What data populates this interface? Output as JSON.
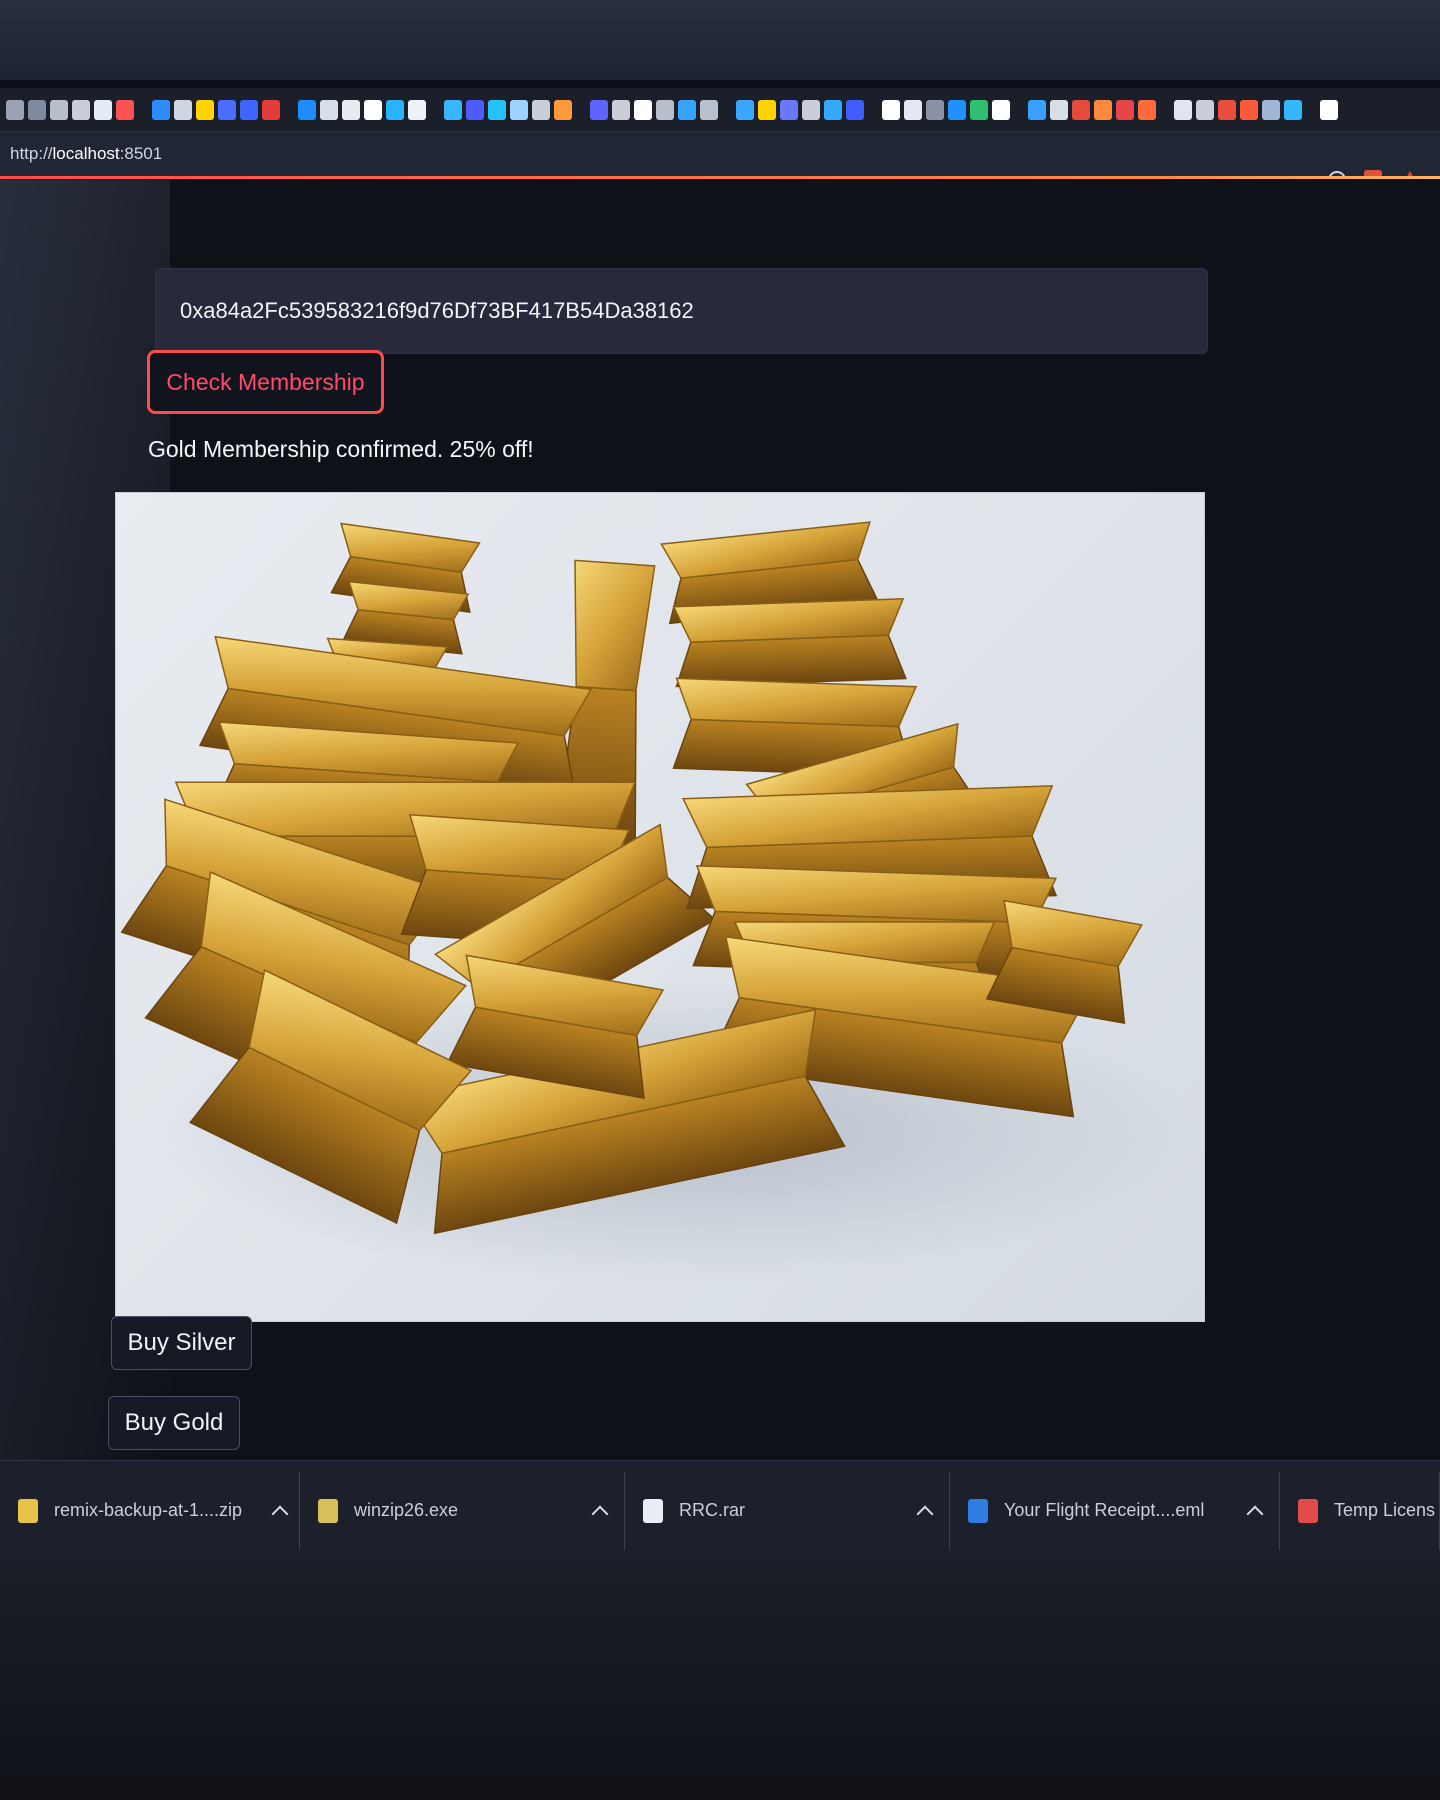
{
  "browser": {
    "url_scheme": "http://",
    "url_host": "localhost",
    "url_port": ":8501",
    "bookmark_icons": [
      "#9aa3b5",
      "#7f8aa0",
      "#b8bfcc",
      "#c8cdd8",
      "#e6ecf5",
      "#ff5252",
      "#2d8cff",
      "#cfd6e3",
      "#ffd400",
      "#4a6cff",
      "#3c66ff",
      "#e33a3a",
      "#1c8cff",
      "#d7deea",
      "#e8ecf2",
      "#ffffff",
      "#2ab3ff",
      "#eef2f7",
      "#38b6ff",
      "#4d5cff",
      "#24c2ff",
      "#9dd3ff",
      "#c7ced9",
      "#ff9a3c",
      "#5e63ff",
      "#c8cdd8",
      "#ffffff",
      "#b7bfcc",
      "#36a4ff",
      "#b7c0cf",
      "#39a6ff",
      "#ffd200",
      "#6a78ff",
      "#c8cdd8",
      "#35a8ff",
      "#3f5cff",
      "#ffffff",
      "#e4e9f1",
      "#8a93a6",
      "#1e90ff",
      "#2fbf71",
      "#ffffff",
      "#38a0ff",
      "#d8dde6",
      "#e64a3c",
      "#ff8a3c",
      "#e64646",
      "#ff6b3c",
      "#e0e5ee",
      "#c8cdd8",
      "#e94e3c",
      "#ff5a3c",
      "#9fb6d4",
      "#34b6ff",
      "#ffffff"
    ]
  },
  "form": {
    "wallet_address": "0xa84a2Fc539583216f9d76Df73BF417B54Da38162",
    "check_button": "Check Membership",
    "status_message": "Gold Membership confirmed. 25% off!"
  },
  "products": {
    "buy_silver": "Buy Silver",
    "buy_gold": "Buy Gold"
  },
  "downloads": [
    {
      "name": "remix-backup-at-1....zip",
      "icon_color": "#e7c34a"
    },
    {
      "name": "winzip26.exe",
      "icon_color": "#d9c05a"
    },
    {
      "name": "RRC.rar",
      "icon_color": "#e9edf4"
    },
    {
      "name": "Your Flight Receipt....eml",
      "icon_color": "#2f7de1"
    },
    {
      "name": "Temp Licens",
      "icon_color": "#e24a4a"
    }
  ],
  "colors": {
    "accent": "#ff4b4b",
    "app_background": "#0e1117",
    "gold_light": "#f2c94c",
    "gold_mid": "#c9962a",
    "gold_dark": "#7a5210"
  }
}
